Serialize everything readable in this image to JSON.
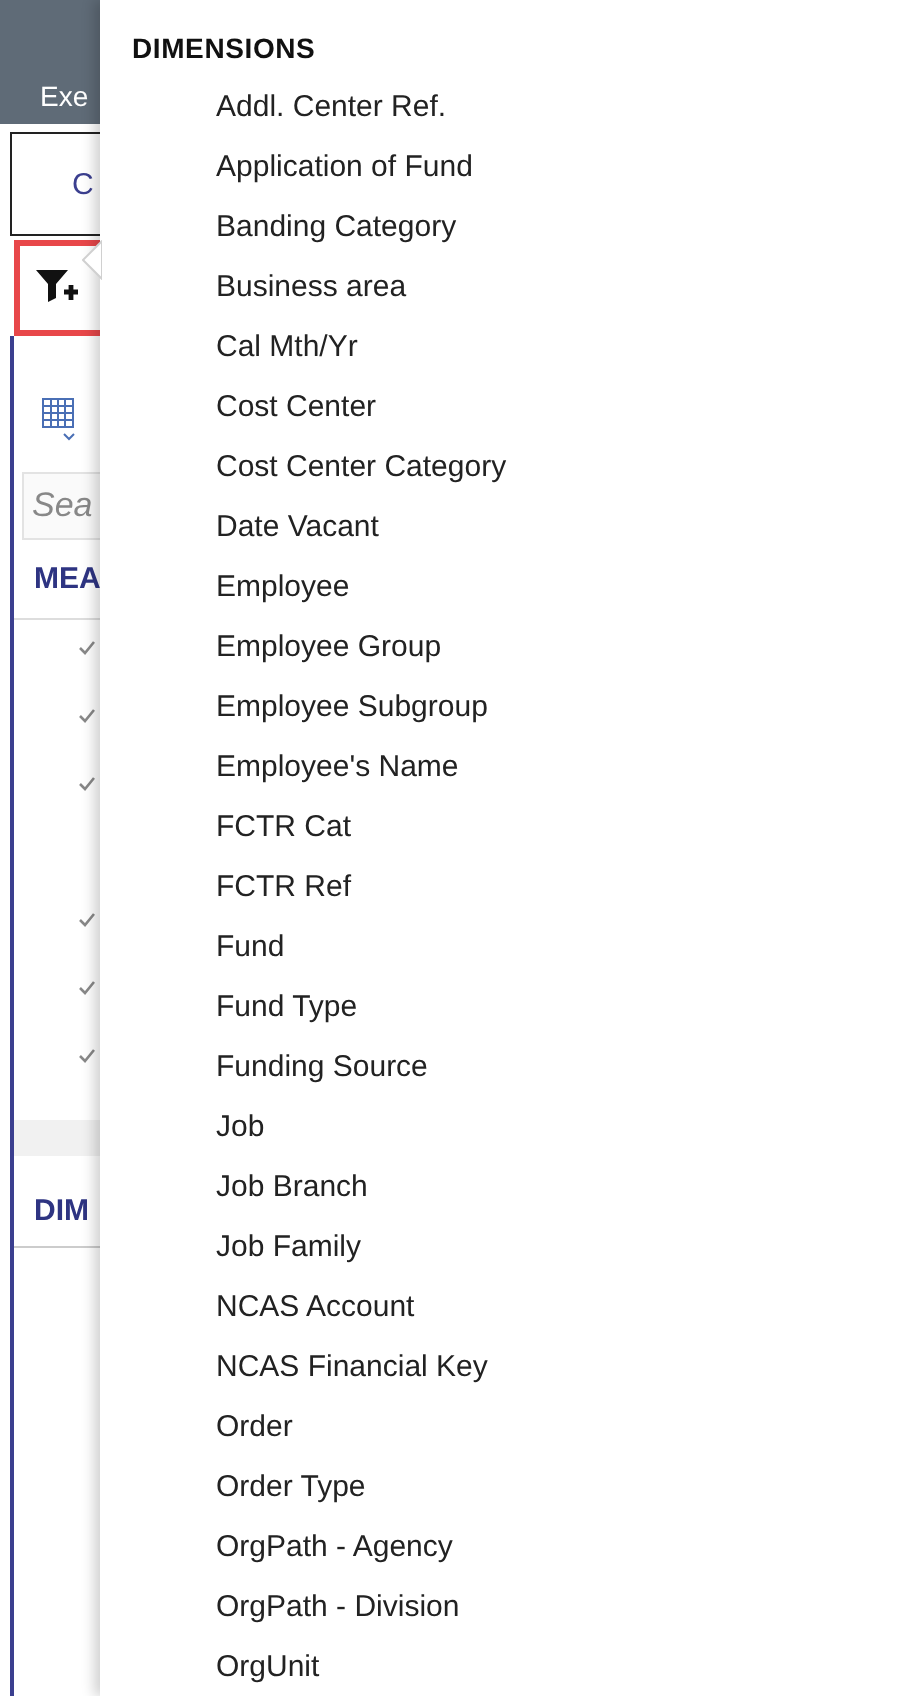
{
  "header": {
    "title": "Exe"
  },
  "tab": {
    "label": "C"
  },
  "filter_button": {
    "highlighted": true
  },
  "search": {
    "placeholder": "Sea"
  },
  "measures": {
    "heading": "MEA",
    "rows": [
      {
        "checked": true
      },
      {
        "checked": true
      },
      {
        "checked": true
      },
      {
        "checked": false
      },
      {
        "checked": true
      },
      {
        "checked": true
      },
      {
        "checked": true
      }
    ]
  },
  "dimensions_section": {
    "heading": "DIM"
  },
  "popup": {
    "heading": "DIMENSIONS",
    "items": [
      "Addl. Center Ref.",
      "Application of Fund",
      "Banding Category",
      "Business area",
      "Cal Mth/Yr",
      "Cost Center",
      "Cost Center Category",
      "Date Vacant",
      "Employee",
      "Employee Group",
      "Employee Subgroup",
      "Employee's Name",
      "FCTR Cat",
      "FCTR Ref",
      "Fund",
      "Fund Type",
      "Funding Source",
      "Job",
      "Job Branch",
      "Job Family",
      "NCAS Account",
      "NCAS Financial Key",
      "Order",
      "Order Type",
      "OrgPath - Agency",
      "OrgPath - Division",
      "OrgUnit"
    ]
  }
}
